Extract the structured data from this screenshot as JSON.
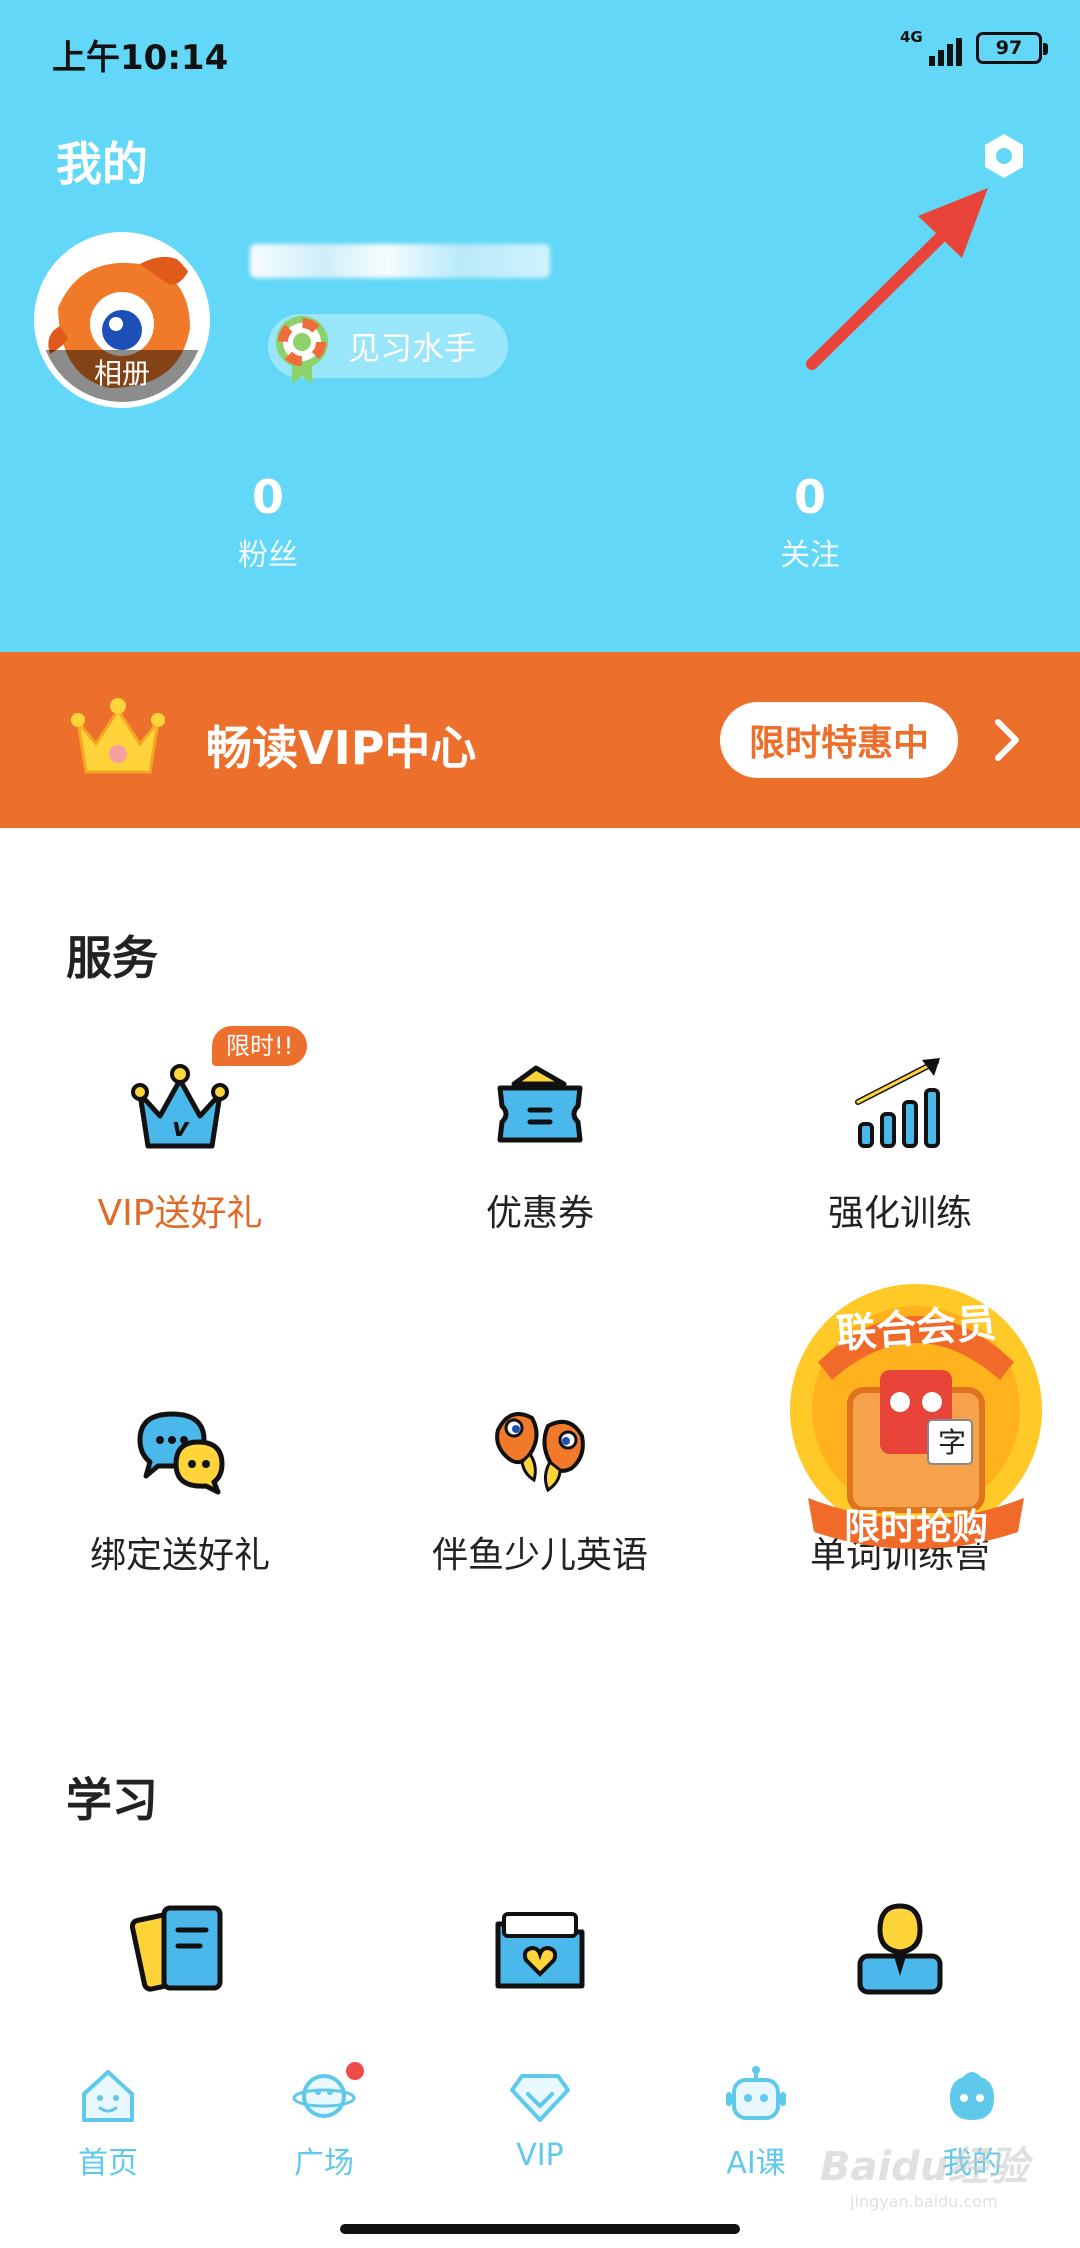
{
  "status_bar": {
    "time": "上午10:14",
    "network": "4G",
    "battery": "97"
  },
  "header": {
    "title": "我的",
    "avatar_label": "相册",
    "level_badge": "见习水手",
    "stats": [
      {
        "value": "0",
        "label": "粉丝"
      },
      {
        "value": "0",
        "label": "关注"
      }
    ]
  },
  "vip_banner": {
    "title": "畅读VIP中心",
    "promo": "限时特惠中"
  },
  "services": {
    "title": "服务",
    "items": [
      {
        "label": "VIP送好礼",
        "icon": "vip-crown-icon",
        "tag": "限时!!"
      },
      {
        "label": "优惠券",
        "icon": "coupon-icon"
      },
      {
        "label": "强化训练",
        "icon": "bar-chart-icon"
      },
      {
        "label": "绑定送好礼",
        "icon": "chat-bubbles-icon"
      },
      {
        "label": "伴鱼少儿英语",
        "icon": "fish-icon"
      },
      {
        "label": "单词训练营",
        "icon": "word-camp-icon"
      }
    ],
    "joint_member": {
      "title": "联合会员",
      "subtitle": "限时抢购",
      "glyph": "字"
    }
  },
  "study": {
    "title": "学习",
    "items": [
      {
        "icon": "notebook-icon"
      },
      {
        "icon": "heart-folder-icon"
      },
      {
        "icon": "teacher-icon"
      }
    ]
  },
  "tabbar": {
    "items": [
      {
        "label": "首页",
        "icon": "home-icon"
      },
      {
        "label": "广场",
        "icon": "planet-icon"
      },
      {
        "label": "VIP",
        "icon": "diamond-icon"
      },
      {
        "label": "AI课",
        "icon": "robot-icon"
      },
      {
        "label": "我的",
        "icon": "profile-icon"
      }
    ]
  },
  "watermark": {
    "brand": "Baidu经验",
    "url": "jingyan.baidu.com"
  },
  "colors": {
    "header_bg": "#63D7F7",
    "vip_bg": "#EC6F2C",
    "accent_orange": "#E06B28",
    "tab_blue": "#5FC9EC",
    "icon_blue": "#4AB8EA",
    "icon_yellow": "#FFD43B"
  }
}
